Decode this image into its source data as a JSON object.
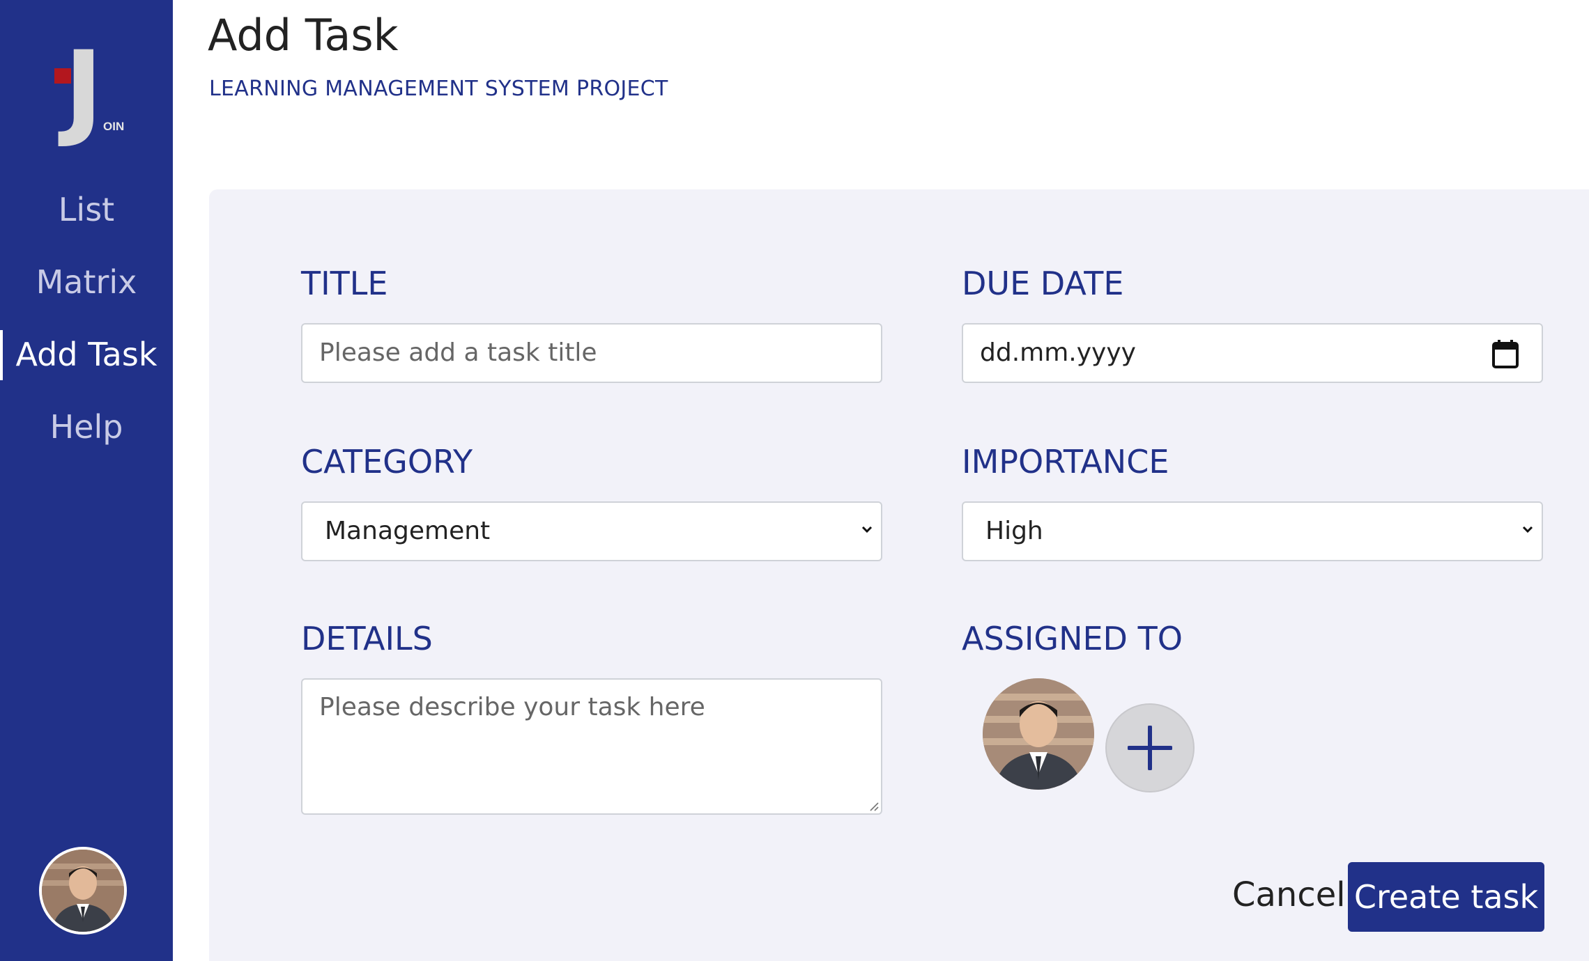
{
  "logo": {
    "letter": "J",
    "suffix": "OIN"
  },
  "sidebar": {
    "items": [
      {
        "label": "List"
      },
      {
        "label": "Matrix"
      },
      {
        "label": "Add Task"
      },
      {
        "label": "Help"
      }
    ],
    "active_item": "Add Task"
  },
  "header": {
    "title": "Add Task",
    "project": "LEARNING MANAGEMENT SYSTEM PROJECT"
  },
  "form": {
    "title": {
      "label": "TITLE",
      "placeholder": "Please add a task title",
      "value": ""
    },
    "due_date": {
      "label": "DUE DATE",
      "placeholder": "dd.mm.yyyy",
      "icon": "calendar-icon"
    },
    "category": {
      "label": "CATEGORY",
      "selected": "Management"
    },
    "importance": {
      "label": "IMPORTANCE",
      "selected": "High"
    },
    "details": {
      "label": "DETAILS",
      "placeholder": "Please describe your task here",
      "value": ""
    },
    "assigned_to": {
      "label": "ASSIGNED TO",
      "add_icon": "plus-icon"
    }
  },
  "actions": {
    "cancel_label": "Cancel",
    "create_label": "Create task"
  },
  "colors": {
    "brand": "#213189",
    "logo_accent": "#b3171e",
    "card_background": "#f2f2f9"
  }
}
